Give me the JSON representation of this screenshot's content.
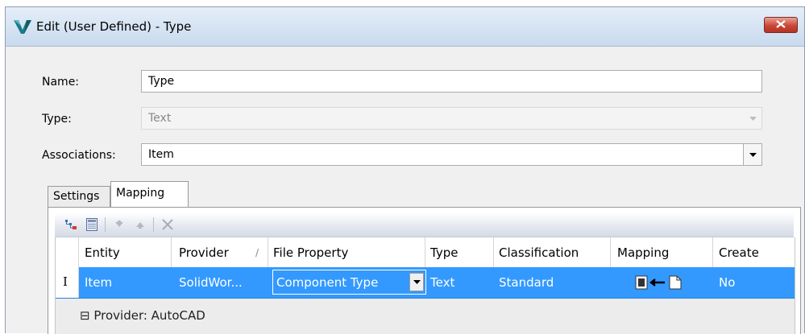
{
  "window": {
    "title": "Edit (User Defined) - Type"
  },
  "form": {
    "name_label": "Name:",
    "name_value": "Type",
    "type_label": "Type:",
    "type_value": "Text",
    "associations_label": "Associations:",
    "associations_value": "Item"
  },
  "tabs": [
    {
      "label": "Settings",
      "active": false
    },
    {
      "label": "Mapping",
      "active": true
    }
  ],
  "toolbar": {
    "icons": [
      "map-hierarchy-icon",
      "properties-icon",
      "move-down-icon",
      "move-up-icon",
      "delete-icon"
    ]
  },
  "grid": {
    "columns": [
      "Entity",
      "Provider",
      "File Property",
      "Type",
      "Classification",
      "Mapping",
      "Create"
    ],
    "sort_indicator": "/",
    "rows": [
      {
        "cursor": "I",
        "entity": "Item",
        "provider": "SolidWor...",
        "file_property": "Component Type",
        "type": "Text",
        "classification": "Standard",
        "mapping": "file-to-property-mapping-icon",
        "create": "No",
        "selected": true
      }
    ],
    "group": {
      "toggle": "⊟",
      "label": "Provider: AutoCAD"
    }
  },
  "colors": {
    "selection": "#3399ff",
    "close_button": "#c9463a",
    "titlebar": "#d6e4f3"
  }
}
